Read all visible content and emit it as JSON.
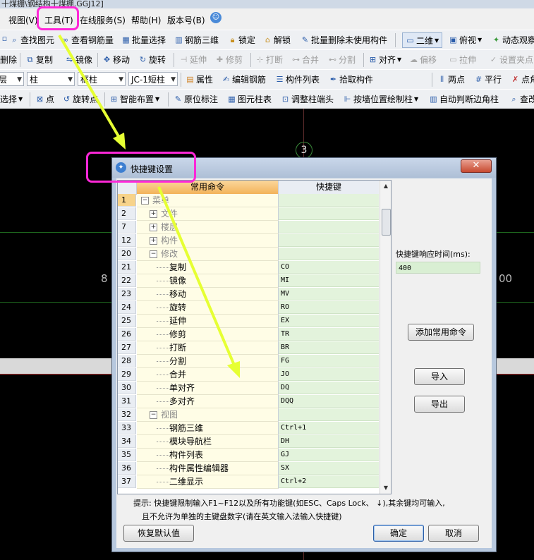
{
  "window": {
    "title": "十煤棚\\钢结构十煤棚.GGJ12]"
  },
  "menu": [
    "视图(V)",
    "工具(T)",
    "在线服务(S)",
    "帮助(H)",
    "版本号(B)"
  ],
  "toolbar1": {
    "find": "查找图元",
    "rebar_qty": "查看钢筋量",
    "batch_select": "批量选择",
    "rebar3d": "钢筋三维",
    "lock": "锁定",
    "unlock": "解锁",
    "batch_delete": "批量删除未使用构件",
    "view2d": "二维",
    "top_view": "俯视",
    "dynamic": "动态观察"
  },
  "toolbar2": {
    "delete": "删除",
    "copy": "复制",
    "mirror": "镜像",
    "move": "移动",
    "rotate": "旋转",
    "extend": "延伸",
    "trim": "修剪",
    "break": "打断",
    "merge": "合并",
    "split": "分割",
    "align": "对齐",
    "offset": "偏移",
    "stretch": "拉伸",
    "set_pivot": "设置夹点"
  },
  "toolbar3": {
    "combo_layer": "层",
    "combo_type": "柱",
    "combo_sub": "框柱",
    "combo_comp": "JC-1短柱",
    "props": "属性",
    "edit_rebar": "编辑钢筋",
    "comp_list": "构件列表",
    "pick": "拾取构件",
    "two_points": "两点",
    "parallel": "平行",
    "point_angle": "点角"
  },
  "toolbar4": {
    "select": "选择",
    "point": "点",
    "rotate_point": "旋转点",
    "smart": "智能布置",
    "orig_label": "原位标注",
    "elem_table": "图元柱表",
    "adjust_end": "调整柱端头",
    "wall_draw": "按墙位置绘制柱",
    "auto_corner": "自动判断边角柱",
    "query": "查改"
  },
  "canvas": {
    "axis_num": "3",
    "left_num": "8",
    "right_num": "00"
  },
  "dialog": {
    "title": "快捷键设置",
    "col_command": "常用命令",
    "col_key": "快捷键",
    "rows": [
      {
        "n": "1",
        "name": "菜单",
        "key": "",
        "level": 0,
        "exp": "−",
        "group": true
      },
      {
        "n": "2",
        "name": "文件",
        "key": "",
        "level": 1,
        "exp": "+",
        "group": true
      },
      {
        "n": "7",
        "name": "楼层",
        "key": "",
        "level": 1,
        "exp": "+",
        "group": true
      },
      {
        "n": "12",
        "name": "构件",
        "key": "",
        "level": 1,
        "exp": "+",
        "group": true
      },
      {
        "n": "20",
        "name": "修改",
        "key": "",
        "level": 1,
        "exp": "−",
        "group": true
      },
      {
        "n": "21",
        "name": "复制",
        "key": "CO",
        "level": 2
      },
      {
        "n": "22",
        "name": "镜像",
        "key": "MI",
        "level": 2
      },
      {
        "n": "23",
        "name": "移动",
        "key": "MV",
        "level": 2
      },
      {
        "n": "24",
        "name": "旋转",
        "key": "RO",
        "level": 2
      },
      {
        "n": "25",
        "name": "延伸",
        "key": "EX",
        "level": 2
      },
      {
        "n": "26",
        "name": "修剪",
        "key": "TR",
        "level": 2
      },
      {
        "n": "27",
        "name": "打断",
        "key": "BR",
        "level": 2
      },
      {
        "n": "28",
        "name": "分割",
        "key": "FG",
        "level": 2
      },
      {
        "n": "29",
        "name": "合并",
        "key": "JO",
        "level": 2
      },
      {
        "n": "30",
        "name": "单对齐",
        "key": "DQ",
        "level": 2
      },
      {
        "n": "31",
        "name": "多对齐",
        "key": "DQQ",
        "level": 2
      },
      {
        "n": "32",
        "name": "视图",
        "key": "",
        "level": 1,
        "exp": "−",
        "group": true
      },
      {
        "n": "33",
        "name": "钢筋三维",
        "key": "Ctrl+1",
        "level": 2
      },
      {
        "n": "34",
        "name": "模块导航栏",
        "key": "DH",
        "level": 2
      },
      {
        "n": "35",
        "name": "构件列表",
        "key": "GJ",
        "level": 2
      },
      {
        "n": "36",
        "name": "构件属性编辑器",
        "key": "SX",
        "level": 2
      },
      {
        "n": "37",
        "name": "二维显示",
        "key": "Ctrl+2",
        "level": 2
      }
    ],
    "response_label": "快捷键响应时间(ms):",
    "response_value": "400",
    "add_common": "添加常用命令",
    "import": "导入",
    "export": "导出",
    "tip_line1": "提示: 快捷键限制输入F1~F12以及所有功能键(如ESC、Caps Lock、 ↓),其余键均可输入,",
    "tip_line2": "且不允许为单独的主键盘数字(请在英文输入法输入快捷键)",
    "restore": "恢复默认值",
    "ok": "确定",
    "cancel": "取消"
  }
}
